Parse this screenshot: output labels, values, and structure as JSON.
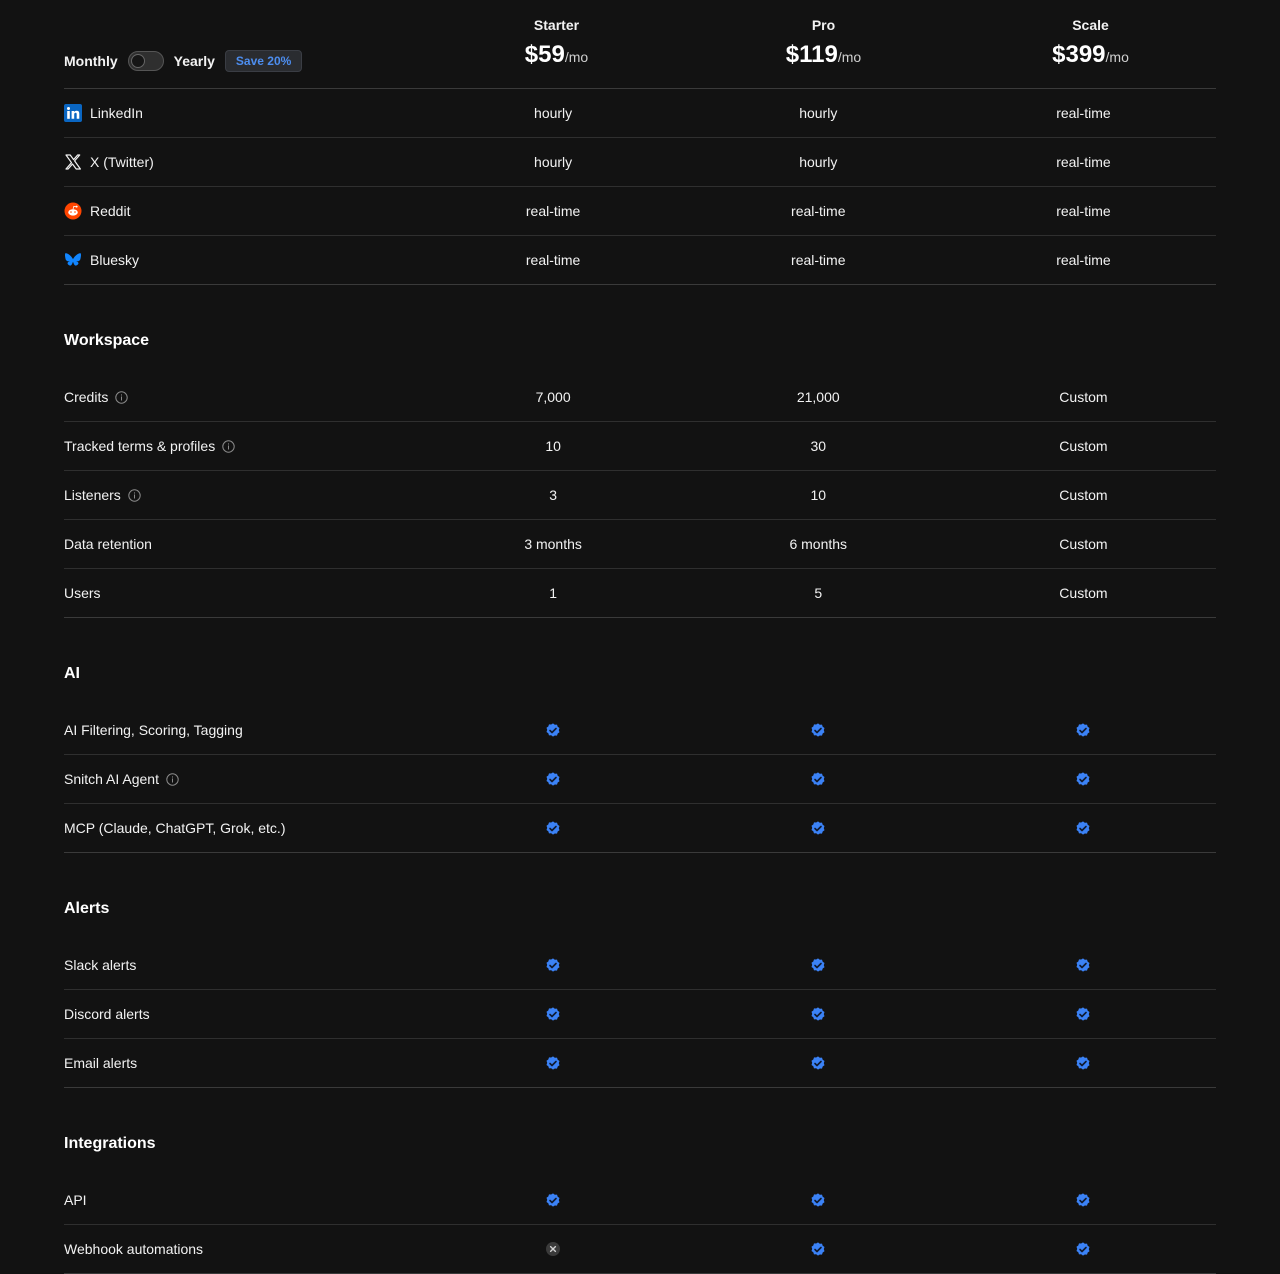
{
  "billing": {
    "monthly_label": "Monthly",
    "yearly_label": "Yearly",
    "save_badge": "Save 20%"
  },
  "plans": [
    {
      "name": "Starter",
      "price": "$59",
      "per": "/mo"
    },
    {
      "name": "Pro",
      "price": "$119",
      "per": "/mo"
    },
    {
      "name": "Scale",
      "price": "$399",
      "per": "/mo"
    }
  ],
  "platforms": [
    {
      "label": "LinkedIn",
      "icon": "linkedin-icon",
      "values": [
        "hourly",
        "hourly",
        "real-time"
      ]
    },
    {
      "label": "X (Twitter)",
      "icon": "x-twitter-icon",
      "values": [
        "hourly",
        "hourly",
        "real-time"
      ]
    },
    {
      "label": "Reddit",
      "icon": "reddit-icon",
      "values": [
        "real-time",
        "real-time",
        "real-time"
      ]
    },
    {
      "label": "Bluesky",
      "icon": "bluesky-icon",
      "values": [
        "real-time",
        "real-time",
        "real-time"
      ]
    }
  ],
  "workspace": {
    "title": "Workspace",
    "rows": [
      {
        "label": "Credits",
        "info": true,
        "values": [
          "7,000",
          "21,000",
          "Custom"
        ]
      },
      {
        "label": "Tracked terms & profiles",
        "info": true,
        "values": [
          "10",
          "30",
          "Custom"
        ]
      },
      {
        "label": "Listeners",
        "info": true,
        "values": [
          "3",
          "10",
          "Custom"
        ]
      },
      {
        "label": "Data retention",
        "info": false,
        "values": [
          "3 months",
          "6 months",
          "Custom"
        ]
      },
      {
        "label": "Users",
        "info": false,
        "values": [
          "1",
          "5",
          "Custom"
        ]
      }
    ]
  },
  "ai": {
    "title": "AI",
    "rows": [
      {
        "label": "AI Filtering, Scoring, Tagging",
        "info": false,
        "values": [
          "check",
          "check",
          "check"
        ]
      },
      {
        "label": "Snitch AI Agent",
        "info": true,
        "values": [
          "check",
          "check",
          "check"
        ]
      },
      {
        "label": "MCP (Claude, ChatGPT, Grok, etc.)",
        "info": false,
        "values": [
          "check",
          "check",
          "check"
        ]
      }
    ]
  },
  "alerts": {
    "title": "Alerts",
    "rows": [
      {
        "label": "Slack alerts",
        "info": false,
        "values": [
          "check",
          "check",
          "check"
        ]
      },
      {
        "label": "Discord alerts",
        "info": false,
        "values": [
          "check",
          "check",
          "check"
        ]
      },
      {
        "label": "Email alerts",
        "info": false,
        "values": [
          "check",
          "check",
          "check"
        ]
      }
    ]
  },
  "integrations": {
    "title": "Integrations",
    "rows": [
      {
        "label": "API",
        "info": false,
        "values": [
          "check",
          "check",
          "check"
        ]
      },
      {
        "label": "Webhook automations",
        "info": false,
        "values": [
          "cross",
          "check",
          "check"
        ]
      }
    ]
  },
  "colors": {
    "background": "#121212",
    "check": "#3b82f6",
    "accent_badge": "#4d8ef0",
    "linkedin": "#0a66c2",
    "reddit": "#ff4500",
    "bluesky": "#1185fe"
  }
}
